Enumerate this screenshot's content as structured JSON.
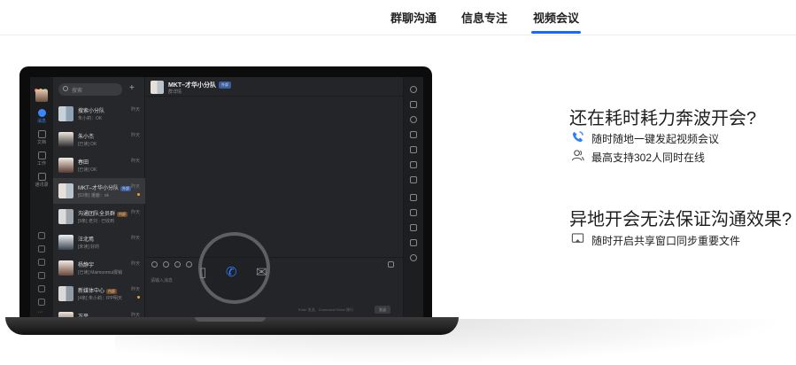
{
  "tabs": [
    {
      "label": "群聊沟通"
    },
    {
      "label": "信息专注"
    },
    {
      "label": "视频会议",
      "active": true
    }
  ],
  "app": {
    "rail": {
      "items": [
        {
          "label": "消息"
        },
        {
          "label": "文档"
        },
        {
          "label": "工作"
        },
        {
          "label": "通讯录"
        }
      ]
    },
    "search_placeholder": "搜索",
    "plus": "+",
    "conversations": [
      {
        "name": "搜索小分队",
        "preview": "朱小莉：OK",
        "time": "昨天"
      },
      {
        "name": "朱小杰",
        "preview": "[已读] OK",
        "time": "昨天"
      },
      {
        "name": "春田",
        "preview": "[已读] OK",
        "time": "昨天"
      },
      {
        "name": "MKT–才华小分队",
        "tag": "外部",
        "preview": "[63条] 潘鹿：ok",
        "time": "昨天"
      },
      {
        "name": "沟通团队全员群",
        "tag": "内部",
        "preview": "[9条] 老刘 : 已收到",
        "time": "昨天"
      },
      {
        "name": "汪北焉",
        "preview": "[未读] 好的",
        "time": "昨天"
      },
      {
        "name": "杨静宇",
        "preview": "[已读] Maimoomui报销",
        "time": "昨天"
      },
      {
        "name": "新媒体中心",
        "tag": "内部",
        "preview": "[4条] 朱小莉：IPP明天",
        "time": "昨天"
      },
      {
        "name": "万平",
        "preview": "",
        "time": "昨天"
      }
    ],
    "chat": {
      "title": "MKT–才华小分队",
      "badge": "外部",
      "subtitle": "群详情",
      "input_placeholder": "请输入消息",
      "hint": "Enter 发送、Command+Enter 换行",
      "send_label": "发送"
    }
  },
  "right": {
    "section1": {
      "heading": "还在耗时耗力奔波开会?",
      "features": [
        {
          "icon": "phone-icon",
          "text": "随时随地一键发起视频会议"
        },
        {
          "icon": "users-icon",
          "text": "最高支持302人同时在线"
        }
      ]
    },
    "section2": {
      "heading": "异地开会无法保证沟通效果?",
      "features": [
        {
          "icon": "screen-share-icon",
          "text": "随时开启共享窗口同步重要文件"
        }
      ]
    }
  },
  "colors": {
    "accent": "#1a66ff",
    "laptop": "#0c0c0c",
    "app_bg": "#232426"
  }
}
